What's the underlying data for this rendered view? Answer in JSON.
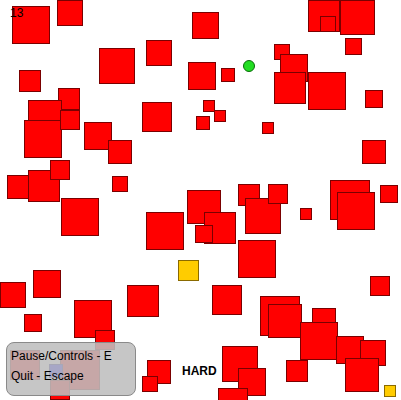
{
  "score": "13",
  "difficulty": "HARD",
  "help_panel": {
    "lines": [
      "Pause/Controls - E",
      "Quit - Escape"
    ]
  },
  "pieces": [
    {
      "kind": "player"
    },
    {
      "kind": "goal"
    },
    {
      "kind": "pickup"
    },
    {
      "kind": "marker"
    },
    {
      "kind": "obstacle"
    },
    {
      "kind": "obstacle"
    },
    {
      "kind": "obstacle"
    },
    {
      "kind": "obstacle"
    },
    {
      "kind": "obstacle"
    },
    {
      "kind": "obstacle"
    },
    {
      "kind": "obstacle"
    },
    {
      "kind": "obstacle"
    },
    {
      "kind": "obstacle"
    },
    {
      "kind": "obstacle"
    },
    {
      "kind": "obstacle"
    },
    {
      "kind": "obstacle"
    },
    {
      "kind": "obstacle"
    },
    {
      "kind": "obstacle"
    },
    {
      "kind": "obstacle"
    },
    {
      "kind": "obstacle"
    },
    {
      "kind": "obstacle"
    },
    {
      "kind": "obstacle"
    },
    {
      "kind": "obstacle"
    },
    {
      "kind": "obstacle"
    },
    {
      "kind": "obstacle"
    },
    {
      "kind": "obstacle"
    },
    {
      "kind": "obstacle"
    },
    {
      "kind": "obstacle"
    },
    {
      "kind": "obstacle"
    },
    {
      "kind": "obstacle"
    },
    {
      "kind": "obstacle"
    },
    {
      "kind": "obstacle"
    },
    {
      "kind": "obstacle"
    },
    {
      "kind": "obstacle"
    },
    {
      "kind": "obstacle"
    },
    {
      "kind": "obstacle"
    },
    {
      "kind": "obstacle"
    },
    {
      "kind": "obstacle"
    },
    {
      "kind": "obstacle"
    },
    {
      "kind": "obstacle"
    },
    {
      "kind": "obstacle"
    },
    {
      "kind": "obstacle"
    },
    {
      "kind": "obstacle"
    },
    {
      "kind": "obstacle"
    },
    {
      "kind": "obstacle"
    },
    {
      "kind": "obstacle"
    },
    {
      "kind": "obstacle"
    },
    {
      "kind": "obstacle"
    },
    {
      "kind": "obstacle"
    },
    {
      "kind": "obstacle"
    },
    {
      "kind": "obstacle"
    },
    {
      "kind": "obstacle"
    },
    {
      "kind": "obstacle"
    },
    {
      "kind": "obstacle"
    },
    {
      "kind": "obstacle"
    },
    {
      "kind": "obstacle"
    },
    {
      "kind": "obstacle"
    },
    {
      "kind": "obstacle"
    },
    {
      "kind": "obstacle"
    },
    {
      "kind": "obstacle"
    },
    {
      "kind": "obstacle"
    },
    {
      "kind": "obstacle"
    },
    {
      "kind": "obstacle"
    },
    {
      "kind": "obstacle"
    },
    {
      "kind": "obstacle"
    },
    {
      "kind": "obstacle"
    },
    {
      "kind": "obstacle"
    },
    {
      "kind": "obstacle"
    },
    {
      "kind": "obstacle"
    },
    {
      "kind": "obstacle"
    },
    {
      "kind": "obstacle"
    },
    {
      "kind": "obstacle"
    },
    {
      "kind": "obstacle"
    },
    {
      "kind": "obstacle"
    }
  ]
}
